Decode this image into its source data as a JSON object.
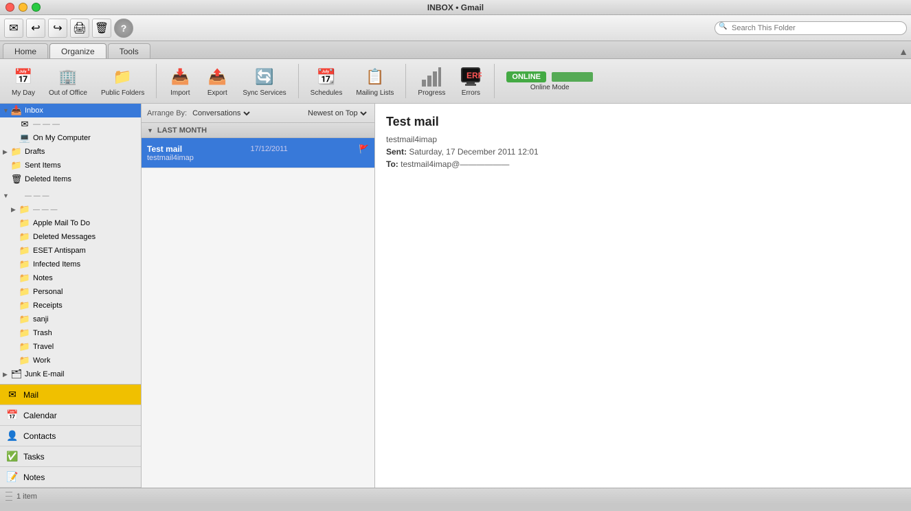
{
  "window": {
    "title": "INBOX • Gmail"
  },
  "tabs": [
    {
      "id": "home",
      "label": "Home",
      "active": false
    },
    {
      "id": "organize",
      "label": "Organize",
      "active": true
    },
    {
      "id": "tools",
      "label": "Tools",
      "active": false
    }
  ],
  "ribbon": {
    "items": [
      {
        "id": "my-day",
        "label": "My Day",
        "icon": "📅"
      },
      {
        "id": "out-of-office",
        "label": "Out of Office",
        "icon": "🏢"
      },
      {
        "id": "public-folders",
        "label": "Public Folders",
        "icon": "📁"
      },
      {
        "id": "import",
        "label": "Import",
        "icon": "📥"
      },
      {
        "id": "export",
        "label": "Export",
        "icon": "📤"
      },
      {
        "id": "sync-services",
        "label": "Sync Services",
        "icon": "🔄"
      },
      {
        "id": "schedules",
        "label": "Schedules",
        "icon": "📆"
      },
      {
        "id": "mailing-lists",
        "label": "Mailing Lists",
        "icon": "📋"
      },
      {
        "id": "progress",
        "label": "Progress",
        "icon": "📊"
      },
      {
        "id": "errors",
        "label": "Errors",
        "icon": "🖥"
      },
      {
        "id": "online-mode",
        "label": "Online Mode",
        "icon": "🌐"
      }
    ],
    "online_status": "ONLINE"
  },
  "sidebar": {
    "tree": [
      {
        "id": "inbox",
        "label": "Inbox",
        "icon": "📥",
        "indent": 1,
        "arrow": "▼",
        "selected": true
      },
      {
        "id": "gmail-account",
        "label": "",
        "icon": "✉",
        "indent": 2,
        "arrow": ""
      },
      {
        "id": "on-my-computer",
        "label": "On My Computer",
        "icon": "💻",
        "indent": 2,
        "arrow": ""
      },
      {
        "id": "drafts",
        "label": "Drafts",
        "icon": "📁",
        "indent": 1,
        "arrow": "▶"
      },
      {
        "id": "sent-items",
        "label": "Sent Items",
        "icon": "📁",
        "indent": 1,
        "arrow": ""
      },
      {
        "id": "deleted-items",
        "label": "Deleted Items",
        "icon": "🗑",
        "indent": 1,
        "arrow": ""
      },
      {
        "id": "account-group",
        "label": "",
        "icon": "",
        "indent": 1,
        "arrow": "▼"
      },
      {
        "id": "account-label",
        "label": "— — —",
        "icon": "📁",
        "indent": 2,
        "arrow": "▶"
      },
      {
        "id": "apple-mail-todo",
        "label": "Apple Mail To Do",
        "icon": "📁",
        "indent": 2,
        "arrow": ""
      },
      {
        "id": "deleted-messages",
        "label": "Deleted Messages",
        "icon": "📁",
        "indent": 2,
        "arrow": ""
      },
      {
        "id": "eset-antispam",
        "label": "ESET Antispam",
        "icon": "📁",
        "indent": 2,
        "arrow": ""
      },
      {
        "id": "infected-items",
        "label": "Infected Items",
        "icon": "📁",
        "indent": 2,
        "arrow": ""
      },
      {
        "id": "notes-folder",
        "label": "Notes",
        "icon": "📁",
        "indent": 2,
        "arrow": ""
      },
      {
        "id": "personal",
        "label": "Personal",
        "icon": "📁",
        "indent": 2,
        "arrow": ""
      },
      {
        "id": "receipts",
        "label": "Receipts",
        "icon": "📁",
        "indent": 2,
        "arrow": ""
      },
      {
        "id": "sanji",
        "label": "sanji",
        "icon": "📁",
        "indent": 2,
        "arrow": ""
      },
      {
        "id": "trash",
        "label": "Trash",
        "icon": "📁",
        "indent": 2,
        "arrow": ""
      },
      {
        "id": "travel",
        "label": "Travel",
        "icon": "📁",
        "indent": 2,
        "arrow": ""
      },
      {
        "id": "work",
        "label": "Work",
        "icon": "📁",
        "indent": 2,
        "arrow": ""
      },
      {
        "id": "junk-email",
        "label": "Junk E-mail",
        "icon": "🗂",
        "indent": 1,
        "arrow": "▶"
      }
    ],
    "nav_items": [
      {
        "id": "mail",
        "label": "Mail",
        "icon": "✉",
        "active": true
      },
      {
        "id": "calendar",
        "label": "Calendar",
        "icon": "📅",
        "active": false
      },
      {
        "id": "contacts",
        "label": "Contacts",
        "icon": "👤",
        "active": false
      },
      {
        "id": "tasks",
        "label": "Tasks",
        "icon": "✅",
        "active": false
      },
      {
        "id": "notes",
        "label": "Notes",
        "icon": "📝",
        "active": false
      }
    ]
  },
  "message_list": {
    "arrange_label": "Arrange By:",
    "arrange_value": "Conversations",
    "newest_label": "Newest on Top",
    "sections": [
      {
        "id": "last-month",
        "label": "LAST MONTH",
        "messages": [
          {
            "id": "msg1",
            "sender": "Test mail",
            "subject": "testmail4imap",
            "date": "17/12/2011",
            "selected": true,
            "flagged": true
          }
        ]
      }
    ]
  },
  "reading_pane": {
    "subject": "Test mail",
    "from": "testmail4imap",
    "sent_label": "Sent:",
    "sent_date": "Saturday, 17 December 2011 12:01",
    "to_label": "To:",
    "to_address": "testmail4imap@——————"
  },
  "statusbar": {
    "item_count": "1 item"
  },
  "search": {
    "placeholder": "Search This Folder"
  }
}
